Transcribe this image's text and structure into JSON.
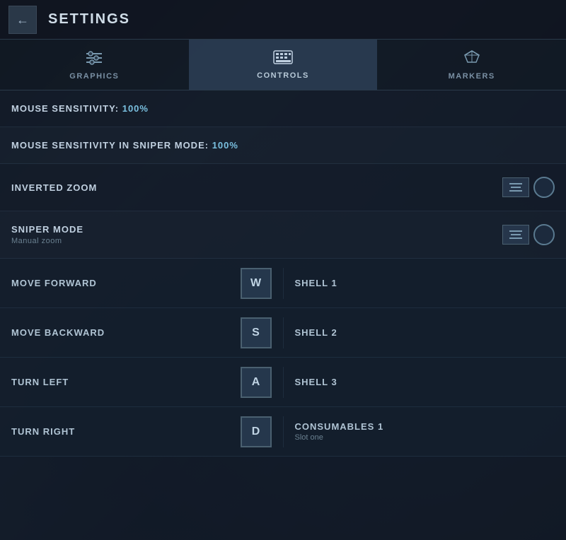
{
  "header": {
    "back_label": "←",
    "title": "SETTINGS"
  },
  "tabs": [
    {
      "id": "graphics",
      "label": "GRAPHICS",
      "icon": "sliders-icon",
      "active": false
    },
    {
      "id": "controls",
      "label": "CONTROLS",
      "icon": "keyboard-icon",
      "active": true
    },
    {
      "id": "markers",
      "label": "MARKERS",
      "icon": "markers-icon",
      "active": false
    }
  ],
  "settings": {
    "mouse_sensitivity": {
      "label": "MOUSE SENSITIVITY: ",
      "value": "100%"
    },
    "mouse_sensitivity_sniper": {
      "label": "MOUSE SENSITIVITY IN SNIPER MODE: ",
      "value": "100%"
    },
    "inverted_zoom": {
      "label": "INVERTED ZOOM"
    },
    "sniper_mode": {
      "label": "SNIPER MODE",
      "sublabel": "Manual zoom"
    }
  },
  "keybindings": [
    {
      "left_action": "MOVE FORWARD",
      "left_key": "W",
      "right_action": "SHELL 1",
      "right_key": "",
      "right_sublabel": ""
    },
    {
      "left_action": "MOVE BACKWARD",
      "left_key": "S",
      "right_action": "SHELL 2",
      "right_key": "",
      "right_sublabel": ""
    },
    {
      "left_action": "TURN LEFT",
      "left_key": "A",
      "right_action": "SHELL 3",
      "right_key": "",
      "right_sublabel": ""
    },
    {
      "left_action": "TURN RIGHT",
      "left_key": "D",
      "right_action": "CONSUMABLES 1",
      "right_sublabel": "Slot one",
      "right_key": ""
    }
  ]
}
